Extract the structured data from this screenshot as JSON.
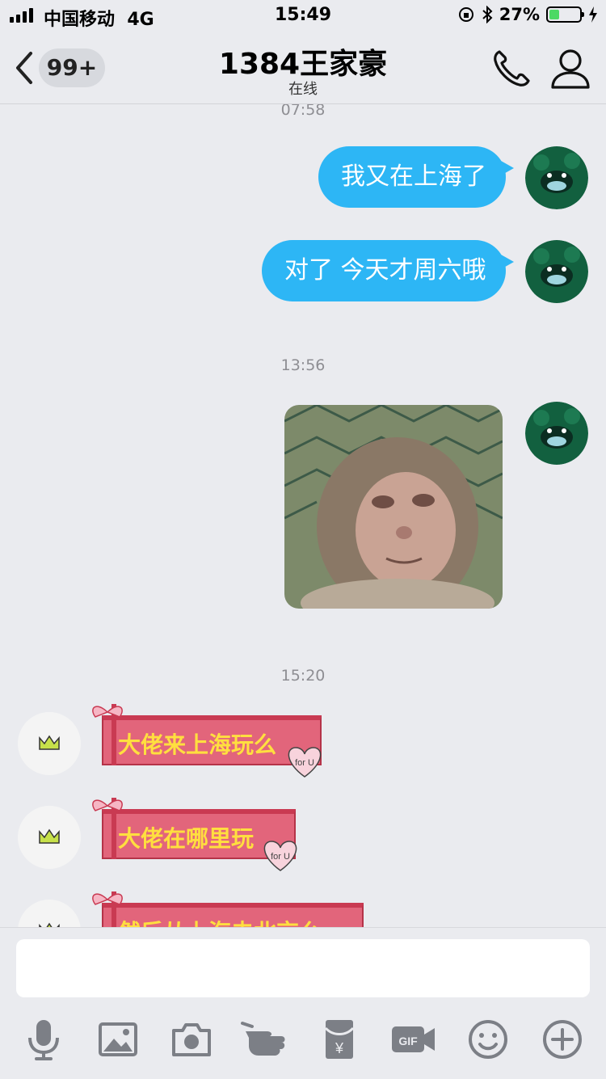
{
  "status_bar": {
    "carrier": "中国移动",
    "network": "4G",
    "time": "15:49",
    "battery": "27%",
    "battery_level": 0.27
  },
  "header": {
    "unread_badge": "99+",
    "title": "1384王家豪",
    "subtitle": "在线"
  },
  "messages": {
    "ts1": "07:58",
    "sent1": "我又在上海了",
    "sent2": "对了 今天才周六哦",
    "ts2": "13:56",
    "ts3": "15:20",
    "recv1": "大佬来上海玩么",
    "recv2": "大佬在哪里玩",
    "recv3": "然后从上海去北京么",
    "sticker_text": "for U"
  },
  "icons": {
    "back": "chevron-left-icon",
    "call": "phone-icon",
    "profile": "person-icon",
    "voice": "microphone-icon",
    "image": "image-icon",
    "camera": "camera-icon",
    "poke": "pointing-hand-icon",
    "red_packet": "red-packet-icon",
    "gif": "gif-icon",
    "emoji": "smiley-icon",
    "more": "plus-circle-icon"
  },
  "colors": {
    "sent_bubble": "#2db6f5",
    "gift_bubble": "#e2657b",
    "gift_text": "#ffdf3f",
    "background": "#eaebef"
  }
}
